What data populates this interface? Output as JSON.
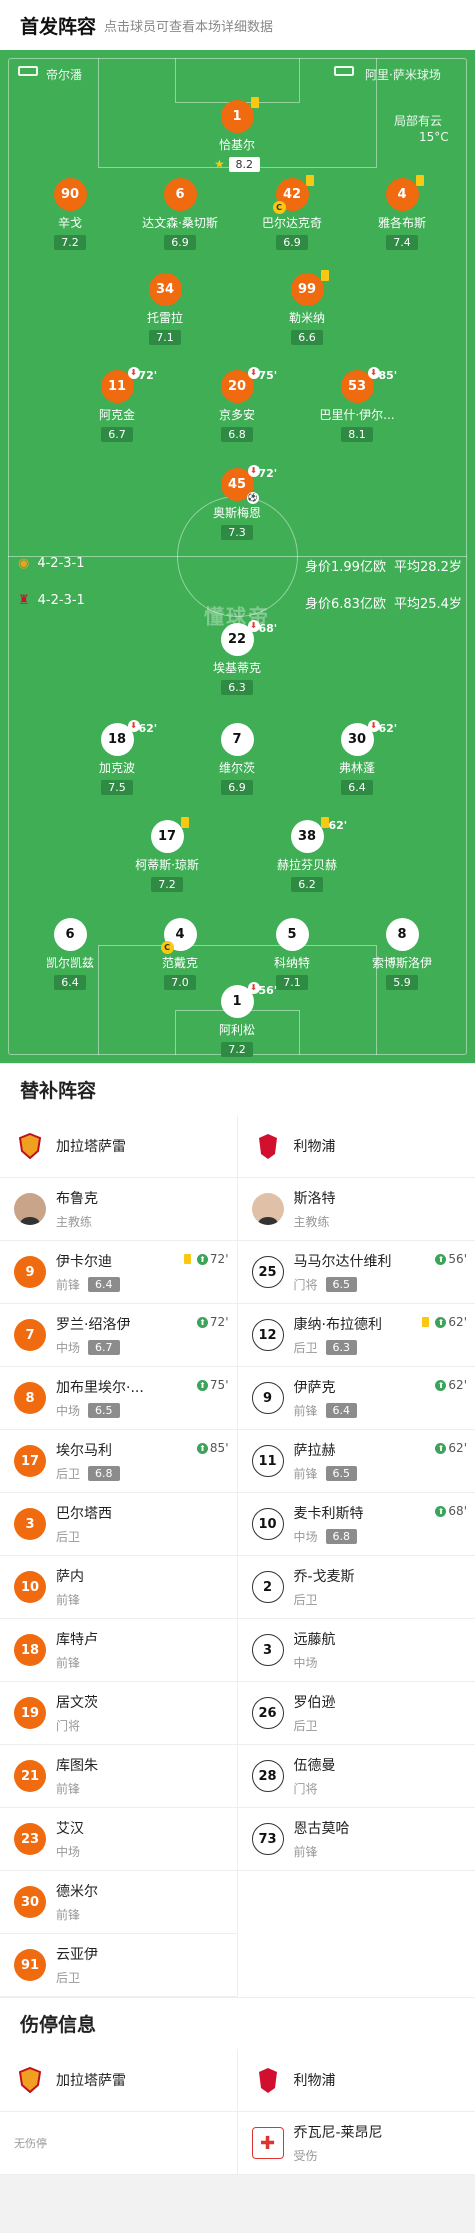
{
  "header": {
    "title": "首发阵容",
    "subtitle": "点击球员可查看本场详细数据"
  },
  "pitch": {
    "home_team": "帝尔潘",
    "away_team": "阿里·萨米球场",
    "weather": "局部有云",
    "temperature": "15°C",
    "watermark": "懂球帝",
    "home_formation": "4-2-3-1",
    "home_value": "身价1.99亿欧",
    "home_age": "平均28.2岁",
    "away_formation": "4-2-3-1",
    "away_value": "身价6.83亿欧",
    "away_age": "平均25.4岁"
  },
  "home_players": [
    {
      "num": "1",
      "name": "恰基尔",
      "rating": "8.2",
      "card": true,
      "star": true
    },
    {
      "num": "90",
      "name": "辛戈",
      "rating": "7.2"
    },
    {
      "num": "6",
      "name": "达文森·桑切斯",
      "rating": "6.9"
    },
    {
      "num": "42",
      "name": "巴尔达克奇",
      "rating": "6.9",
      "card": true,
      "captain": true
    },
    {
      "num": "4",
      "name": "雅各布斯",
      "rating": "7.4",
      "card": true
    },
    {
      "num": "34",
      "name": "托雷拉",
      "rating": "7.1"
    },
    {
      "num": "99",
      "name": "勒米纳",
      "rating": "6.6",
      "card": true
    },
    {
      "num": "11",
      "name": "阿克金",
      "rating": "6.7",
      "sub": "72'"
    },
    {
      "num": "20",
      "name": "京多安",
      "rating": "6.8",
      "sub": "75'"
    },
    {
      "num": "53",
      "name": "巴里什·伊尔...",
      "rating": "8.1",
      "sub": "85'"
    },
    {
      "num": "45",
      "name": "奥斯梅恩",
      "rating": "7.3",
      "sub": "72'",
      "goal": true
    }
  ],
  "away_players": [
    {
      "num": "22",
      "name": "埃基蒂克",
      "rating": "6.3",
      "sub": "68'"
    },
    {
      "num": "18",
      "name": "加克波",
      "rating": "7.5",
      "sub": "62'"
    },
    {
      "num": "7",
      "name": "维尔茨",
      "rating": "6.9"
    },
    {
      "num": "30",
      "name": "弗林蓬",
      "rating": "6.4",
      "sub": "62'"
    },
    {
      "num": "17",
      "name": "柯蒂斯·琼斯",
      "rating": "7.2",
      "card": true
    },
    {
      "num": "38",
      "name": "赫拉芬贝赫",
      "rating": "6.2",
      "sub": "62'",
      "card": true
    },
    {
      "num": "6",
      "name": "凯尔凯兹",
      "rating": "6.4"
    },
    {
      "num": "4",
      "name": "范戴克",
      "rating": "7.0",
      "captain": true
    },
    {
      "num": "5",
      "name": "科纳特",
      "rating": "7.1"
    },
    {
      "num": "8",
      "name": "索博斯洛伊",
      "rating": "5.9"
    },
    {
      "num": "1",
      "name": "阿利松",
      "rating": "7.2",
      "sub": "56'"
    }
  ],
  "subs": {
    "title": "替补阵容",
    "home_team": "加拉塔萨雷",
    "away_team": "利物浦",
    "home_coach": {
      "name": "布鲁克",
      "role": "主教练"
    },
    "away_coach": {
      "name": "斯洛特",
      "role": "主教练"
    },
    "home": [
      {
        "num": "9",
        "name": "伊卡尔迪",
        "pos": "前锋",
        "rating": "6.4",
        "minute": "72'",
        "card": true
      },
      {
        "num": "7",
        "name": "罗兰·绍洛伊",
        "pos": "中场",
        "rating": "6.7",
        "minute": "72'"
      },
      {
        "num": "8",
        "name": "加布里埃尔·...",
        "pos": "中场",
        "rating": "6.5",
        "minute": "75'"
      },
      {
        "num": "17",
        "name": "埃尔马利",
        "pos": "后卫",
        "rating": "6.8",
        "minute": "85'"
      },
      {
        "num": "3",
        "name": "巴尔塔西",
        "pos": "后卫"
      },
      {
        "num": "10",
        "name": "萨内",
        "pos": "前锋"
      },
      {
        "num": "18",
        "name": "库特卢",
        "pos": "前锋"
      },
      {
        "num": "19",
        "name": "居文茨",
        "pos": "门将"
      },
      {
        "num": "21",
        "name": "库图朱",
        "pos": "前锋"
      },
      {
        "num": "23",
        "name": "艾汉",
        "pos": "中场"
      },
      {
        "num": "30",
        "name": "德米尔",
        "pos": "前锋"
      },
      {
        "num": "91",
        "name": "云亚伊",
        "pos": "后卫"
      }
    ],
    "away": [
      {
        "num": "25",
        "name": "马马尔达什维利",
        "pos": "门将",
        "rating": "6.5",
        "minute": "56'"
      },
      {
        "num": "12",
        "name": "康纳·布拉德利",
        "pos": "后卫",
        "rating": "6.3",
        "minute": "62'",
        "card": true
      },
      {
        "num": "9",
        "name": "伊萨克",
        "pos": "前锋",
        "rating": "6.4",
        "minute": "62'"
      },
      {
        "num": "11",
        "name": "萨拉赫",
        "pos": "前锋",
        "rating": "6.5",
        "minute": "62'"
      },
      {
        "num": "10",
        "name": "麦卡利斯特",
        "pos": "中场",
        "rating": "6.8",
        "minute": "68'"
      },
      {
        "num": "2",
        "name": "乔-戈麦斯",
        "pos": "后卫"
      },
      {
        "num": "3",
        "name": "远藤航",
        "pos": "中场"
      },
      {
        "num": "26",
        "name": "罗伯逊",
        "pos": "后卫"
      },
      {
        "num": "28",
        "name": "伍德曼",
        "pos": "门将"
      },
      {
        "num": "73",
        "name": "恩古莫哈",
        "pos": "前锋"
      }
    ]
  },
  "injury": {
    "title": "伤停信息",
    "home_team": "加拉塔萨雷",
    "away_team": "利物浦",
    "home_note": "无伤停",
    "away_player": {
      "name": "乔瓦尼-莱昂尼",
      "status": "受伤"
    }
  }
}
